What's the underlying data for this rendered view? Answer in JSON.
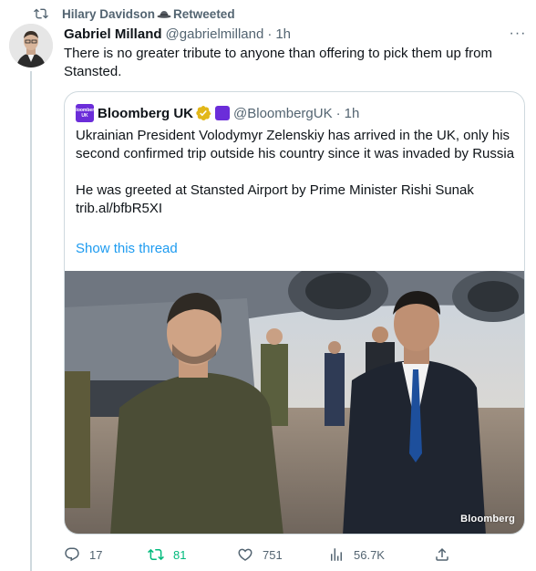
{
  "retweet": {
    "text": "Hilary Davidson",
    "suffix": "Retweeted",
    "hat_icon": "hat-emoji"
  },
  "tweet": {
    "author_name": "Gabriel Milland",
    "author_handle": "@gabrielmilland",
    "dot": "·",
    "time": "1h",
    "more": "···",
    "text": "There is no greater tribute to anyone than offering to pick them up from Stansted."
  },
  "quote": {
    "logo_text": "Bloomberg UK",
    "author_name": "Bloomberg UK",
    "author_handle": "@BloombergUK",
    "dot": "·",
    "time": "1h",
    "paragraph1": "Ukrainian President Volodymyr Zelenskiy has arrived in the UK, only his second confirmed trip outside his country since it was invaded by Russia",
    "paragraph2_line1": "He was greeted at Stansted Airport by Prime Minister Rishi Sunak",
    "paragraph2_line2": "trib.al/bfbR5XI",
    "show_thread": "Show this thread",
    "photo_credit": "Bloomberg"
  },
  "actions": {
    "replies": "17",
    "retweets": "81",
    "likes": "751",
    "views": "56.7K"
  },
  "colors": {
    "accent": "#1d9bf0",
    "retweet_green": "#00ba7c",
    "muted": "#536471",
    "border": "#cfd9de",
    "bloomberg_purple": "#6b2dd9"
  },
  "icons": [
    "retweet-icon",
    "more-icon",
    "verified-gold-icon",
    "reply-icon",
    "retweet-icon",
    "like-icon",
    "views-icon",
    "share-icon"
  ]
}
